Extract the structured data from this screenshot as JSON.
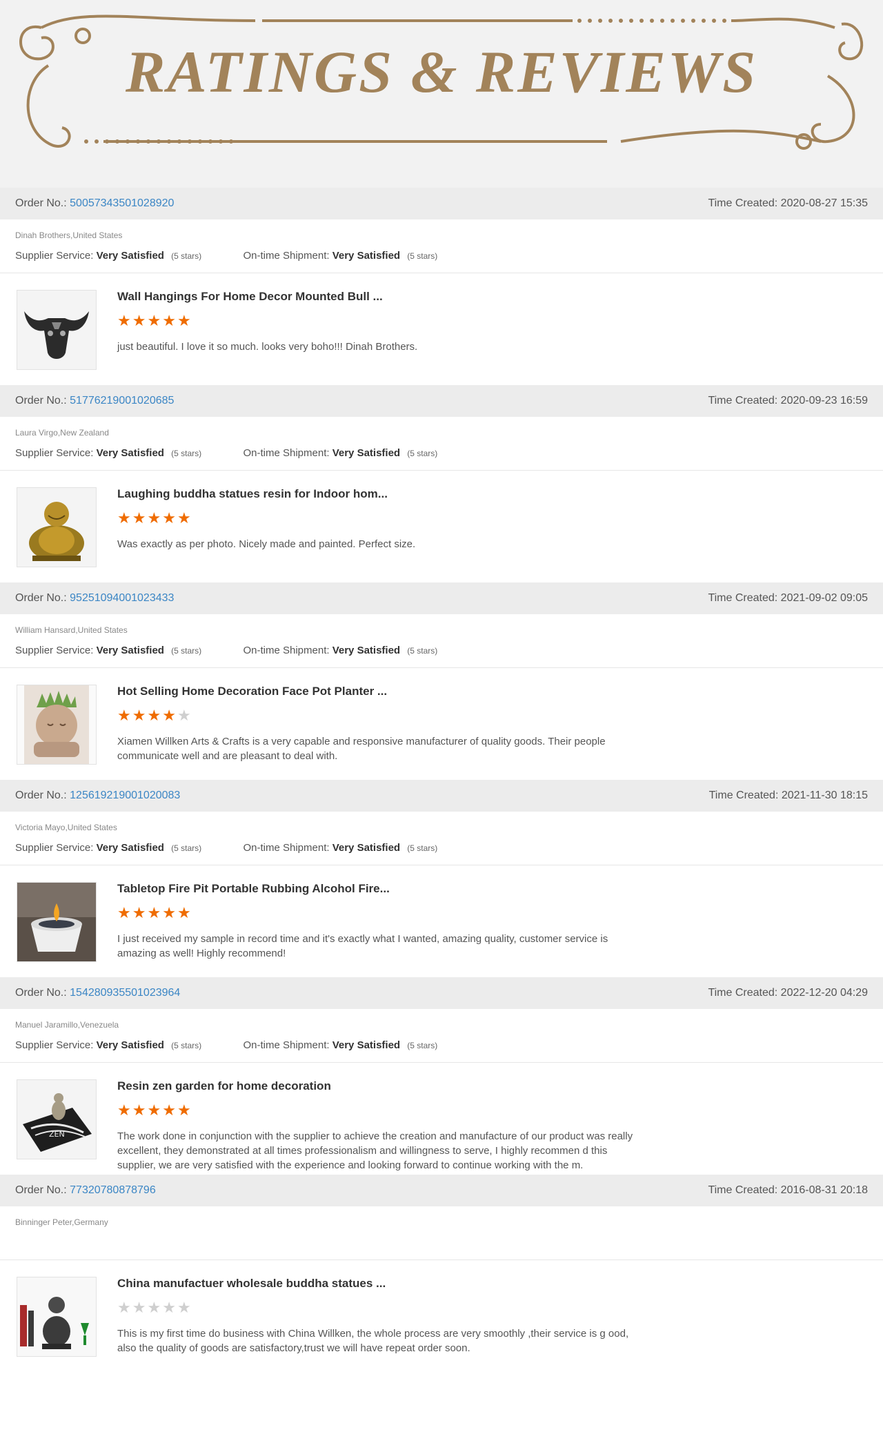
{
  "banner": {
    "title": "RATINGS & REVIEWS"
  },
  "labels": {
    "order_no": "Order No.:",
    "time_created": "Time Created:",
    "supplier_service": "Supplier Service:",
    "ontime_shipment": "On-time Shipment:"
  },
  "colors": {
    "star_on": "#ef6c00",
    "star_off": "#cfcfcf",
    "link": "#3b86c5",
    "banner_gold": "#a2835a"
  },
  "reviews": [
    {
      "order_no": "50057343501028920",
      "time_created": "2020-08-27 15:35",
      "buyer": "Dinah Brothers,United States",
      "supplier_service": "Very Satisfied",
      "supplier_stars": "(5 stars)",
      "shipment": "Very Satisfied",
      "shipment_stars": "(5 stars)",
      "product_title": "Wall Hangings For Home Decor Mounted Bull ...",
      "rating": 5,
      "comment": "just beautiful.  I love it so much. looks very boho!!!  Dinah Brothers.",
      "thumb_icon": "bull-skull-image"
    },
    {
      "order_no": "51776219001020685",
      "time_created": "2020-09-23 16:59",
      "buyer": "Laura Virgo,New Zealand",
      "supplier_service": "Very Satisfied",
      "supplier_stars": "(5 stars)",
      "shipment": "Very Satisfied",
      "shipment_stars": "(5 stars)",
      "product_title": "Laughing buddha statues resin for Indoor hom...",
      "rating": 5,
      "comment": "Was exactly as per photo.  Nicely made and painted.  Perfect size.",
      "thumb_icon": "laughing-buddha-image"
    },
    {
      "order_no": "95251094001023433",
      "time_created": "2021-09-02 09:05",
      "buyer": "William Hansard,United States",
      "supplier_service": "Very Satisfied",
      "supplier_stars": "(5 stars)",
      "shipment": "Very Satisfied",
      "shipment_stars": "(5 stars)",
      "product_title": "Hot Selling Home Decoration Face Pot Planter ...",
      "rating": 4,
      "comment": "Xiamen Willken Arts & Crafts is a very capable and responsive manufacturer of quality goods. Their people communicate well and are pleasant to deal with.",
      "thumb_icon": "face-planter-image"
    },
    {
      "order_no": "125619219001020083",
      "time_created": "2021-11-30 18:15",
      "buyer": "Victoria Mayo,United States",
      "supplier_service": "Very Satisfied",
      "supplier_stars": "(5 stars)",
      "shipment": "Very Satisfied",
      "shipment_stars": "(5 stars)",
      "product_title": "Tabletop Fire Pit Portable Rubbing Alcohol Fire...",
      "rating": 5,
      "comment": "I just received my sample in record time and it's exactly what I wanted, amazing quality, customer service is amazing as well! Highly recommend!",
      "thumb_icon": "fire-pit-image"
    },
    {
      "order_no": "154280935501023964",
      "time_created": "2022-12-20 04:29",
      "buyer": "Manuel Jaramillo,Venezuela",
      "supplier_service": "Very Satisfied",
      "supplier_stars": "(5 stars)",
      "shipment": "Very Satisfied",
      "shipment_stars": "(5 stars)",
      "product_title": "Resin zen garden for home decoration",
      "rating": 5,
      "comment": "The work done in conjunction with the supplier to achieve the creation and manufacture of our product was really excellent, they demonstrated at all times professionalism and willingness to serve, I highly recommen d this supplier, we are very satisfied with the experience and looking forward to continue working with the m.",
      "thumb_icon": "zen-garden-image"
    },
    {
      "order_no": "77320780878796",
      "time_created": "2016-08-31 20:18",
      "buyer": "Binninger Peter,Germany",
      "product_title": "China manufactuer wholesale buddha statues ...",
      "rating": 0,
      "comment": "This is my first time do business with China Willken, the whole process are very smoothly ,their service is g ood, also the quality of goods are satisfactory,trust we will have repeat order soon.",
      "thumb_icon": "buddha-statue-image"
    }
  ]
}
